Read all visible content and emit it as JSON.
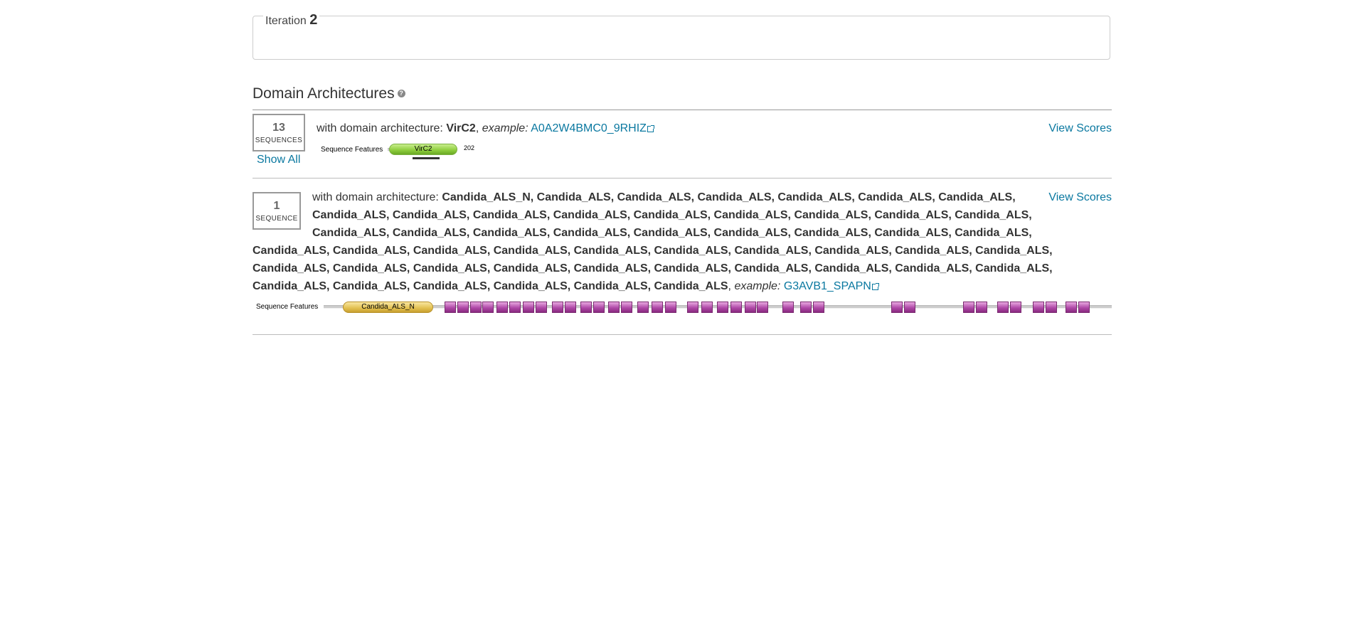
{
  "iteration": {
    "label": "Iteration",
    "number": "2"
  },
  "section": {
    "title": "Domain Architectures",
    "help_icon": "?"
  },
  "architectures": [
    {
      "count": "13",
      "count_label": "SEQUENCES",
      "show_all": "Show All",
      "prefix": "with domain architecture: ",
      "domains_text": "VirC2",
      "example_label": "example:",
      "example_link": "A0A2W4BMC0_9RHIZ",
      "view_scores": "View Scores",
      "features_label": "Sequence Features",
      "domain_pill": "VirC2",
      "length": "202"
    },
    {
      "count": "1",
      "count_label": "SEQUENCE",
      "prefix": "with domain architecture: ",
      "domains_line1": "Candida_ALS_N, Candida_ALS, Candida_ALS, Candida_ALS, Candida_ALS, Candida_ALS, Candida_ALS,",
      "domains_line2": "Candida_ALS, Candida_ALS, Candida_ALS, Candida_ALS, Candida_ALS, Candida_ALS, Candida_ALS, Candida_ALS, Candida_ALS,",
      "domains_line3": "Candida_ALS, Candida_ALS, Candida_ALS, Candida_ALS, Candida_ALS, Candida_ALS, Candida_ALS, Candida_ALS, Candida_ALS,",
      "domains_line4": "Candida_ALS, Candida_ALS, Candida_ALS, Candida_ALS, Candida_ALS, Candida_ALS, Candida_ALS, Candida_ALS, Candida_ALS, Candida_ALS,",
      "domains_line5": "Candida_ALS, Candida_ALS, Candida_ALS, Candida_ALS, Candida_ALS, Candida_ALS, Candida_ALS, Candida_ALS, Candida_ALS, Candida_ALS,",
      "domains_line6": "Candida_ALS, Candida_ALS, Candida_ALS, Candida_ALS, Candida_ALS, Candida_ALS",
      "example_label": "example:",
      "example_link": "G3AVB1_SPAPN",
      "view_scores": "View Scores",
      "features_label": "Sequence Features",
      "domain_pill": "Candida_ALS_N"
    }
  ],
  "colors": {
    "link": "#0a78a0",
    "virc2": "#8ccc3c",
    "candida_als_n": "#e2c050",
    "candida_als": "#b04aa8"
  }
}
